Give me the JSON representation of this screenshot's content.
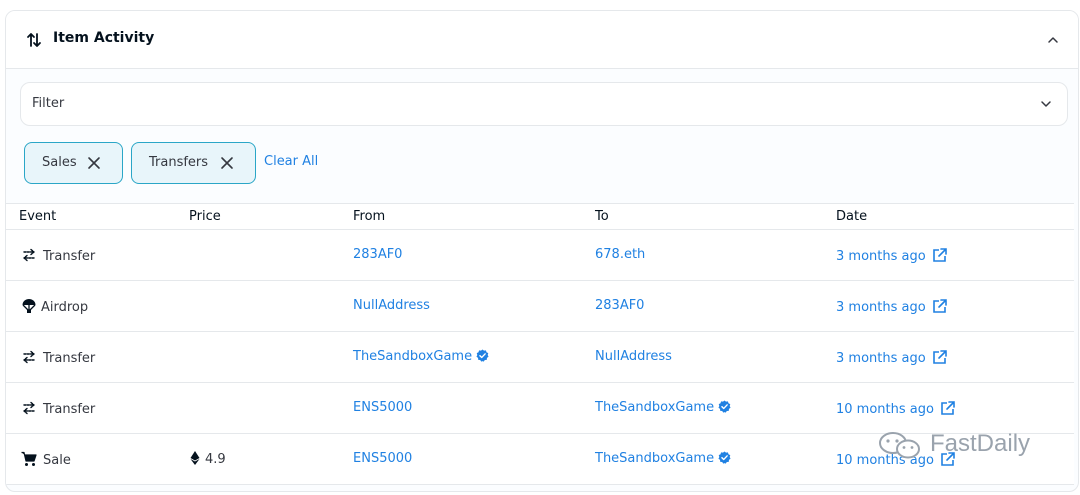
{
  "header": {
    "title": "Item Activity",
    "icon": "sort-arrows-icon",
    "collapse_icon": "chevron-up-icon"
  },
  "filter": {
    "label": "Filter",
    "icon": "chevron-down-icon"
  },
  "chips": [
    {
      "label": "Sales",
      "icon": "close-icon"
    },
    {
      "label": "Transfers",
      "icon": "close-icon"
    }
  ],
  "clear_all": "Clear All",
  "table": {
    "columns": [
      "Event",
      "Price",
      "From",
      "To",
      "Date"
    ],
    "rows": [
      {
        "event": "Transfer",
        "event_icon": "transfer-icon",
        "price": "",
        "from": "283AF0",
        "from_verified": false,
        "to": "678.eth",
        "to_verified": false,
        "date": "3 months ago"
      },
      {
        "event": "Airdrop",
        "event_icon": "airdrop-icon",
        "price": "",
        "from": "NullAddress",
        "from_verified": false,
        "to": "283AF0",
        "to_verified": false,
        "date": "3 months ago"
      },
      {
        "event": "Transfer",
        "event_icon": "transfer-icon",
        "price": "",
        "from": "TheSandboxGame",
        "from_verified": true,
        "to": "NullAddress",
        "to_verified": false,
        "date": "3 months ago"
      },
      {
        "event": "Transfer",
        "event_icon": "transfer-icon",
        "price": "",
        "from": "ENS5000",
        "from_verified": false,
        "to": "TheSandboxGame",
        "to_verified": true,
        "date": "10 months ago"
      },
      {
        "event": "Sale",
        "event_icon": "cart-icon",
        "price": "4.9",
        "from": "ENS5000",
        "from_verified": false,
        "to": "TheSandboxGame",
        "to_verified": true,
        "date": "10 months ago"
      }
    ]
  },
  "watermark": {
    "text": "FastDaily",
    "icon": "wechat-icon"
  },
  "colors": {
    "link": "#2081e2",
    "chip_border": "#2aa6c7",
    "chip_bg": "#e8f5fa",
    "text": "#04111d"
  }
}
